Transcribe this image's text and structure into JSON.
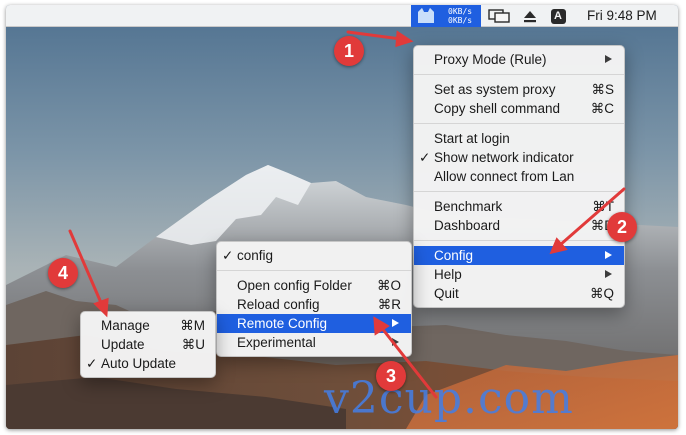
{
  "menubar": {
    "speed_up": "0KB/s",
    "speed_down": "0KB/s",
    "clock": "Fri 9:48 PM",
    "icons": [
      "proxy-status-icon",
      "airplay-display-icon",
      "eject-icon",
      "input-source-icon"
    ],
    "input_source_letter": "A",
    "active_color": "#1F5FE0"
  },
  "main_menu": {
    "proxy_mode": "Proxy Mode (Rule)",
    "set_system_proxy": "Set as system proxy",
    "set_system_proxy_shortcut": "⌘S",
    "copy_shell": "Copy shell command",
    "copy_shell_shortcut": "⌘C",
    "start_login": "Start at login",
    "show_network": "Show network indicator",
    "allow_lan": "Allow connect from Lan",
    "benchmark": "Benchmark",
    "benchmark_shortcut": "⌘T",
    "dashboard": "Dashboard",
    "dashboard_shortcut": "⌘D",
    "config": "Config",
    "help": "Help",
    "quit": "Quit",
    "quit_shortcut": "⌘Q"
  },
  "config_menu": {
    "config_item": "config",
    "open_folder": "Open config Folder",
    "open_folder_shortcut": "⌘O",
    "reload": "Reload config",
    "reload_shortcut": "⌘R",
    "remote_config": "Remote Config",
    "experimental": "Experimental"
  },
  "remote_menu": {
    "manage": "Manage",
    "manage_shortcut": "⌘M",
    "update": "Update",
    "update_shortcut": "⌘U",
    "auto_update": "Auto Update"
  },
  "checkmark": "✓",
  "badges": [
    "1",
    "2",
    "3",
    "4"
  ],
  "badge_color": "#E13A3A",
  "watermark": "v2cup.com"
}
